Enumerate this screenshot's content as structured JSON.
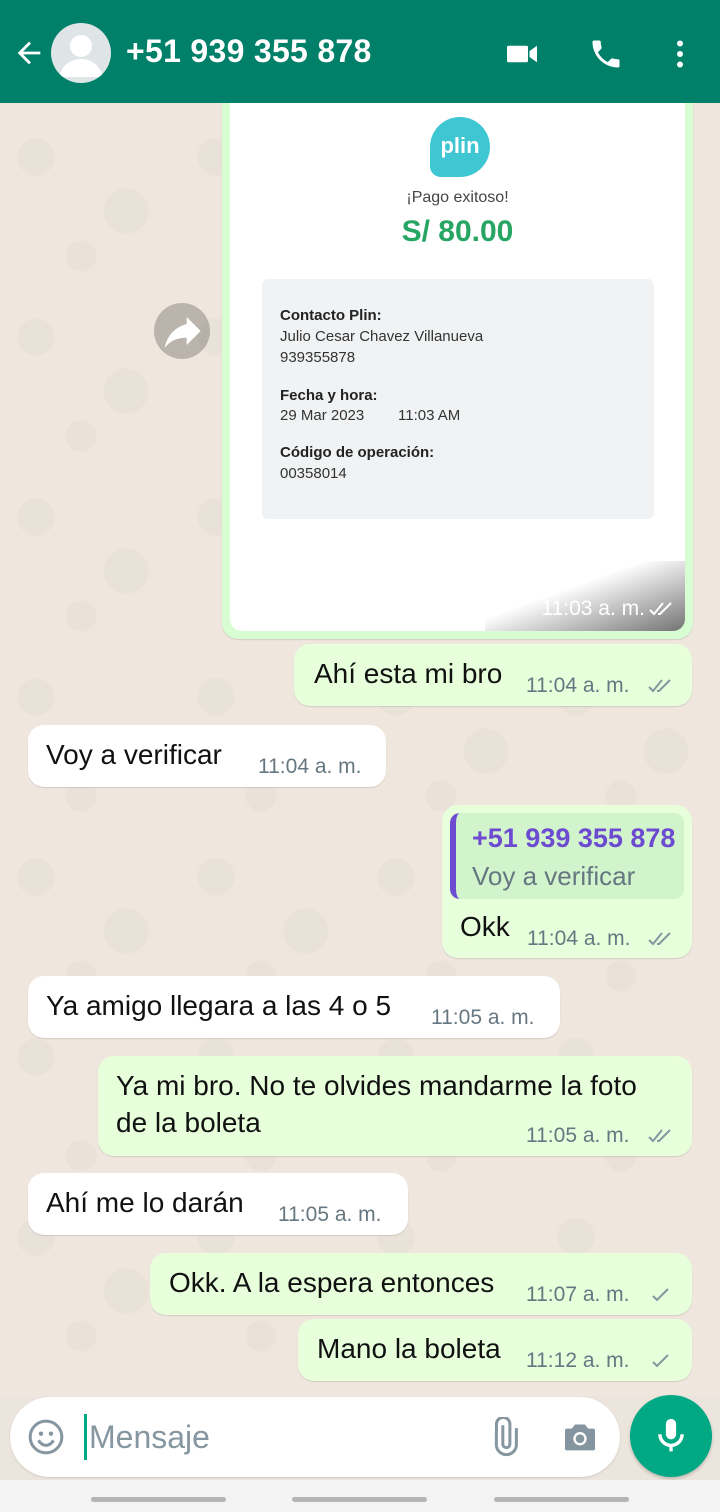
{
  "header": {
    "title": "+51 939 355 878",
    "icons": [
      "back-arrow-icon",
      "avatar",
      "video-call-icon",
      "phone-icon",
      "more-options-icon"
    ]
  },
  "image_message": {
    "logo_text": "plin",
    "status": "¡Pago exitoso!",
    "amount": "S/ 80.00",
    "contact_label": "Contacto Plin:",
    "contact_name": "Julio Cesar Chavez Villanueva",
    "contact_phone": "939355878",
    "datetime_label": "Fecha y hora:",
    "date": "29 Mar 2023",
    "time_value": "11:03 AM",
    "op_label": "Código de operación:",
    "op_code": "00358014",
    "time": "11:03 a. m."
  },
  "messages": [
    {
      "direction": "out",
      "text": "Ahí esta mi bro",
      "time": "11:04 a. m.",
      "status": "read"
    },
    {
      "direction": "in",
      "text": "Voy a verificar",
      "time": "11:04 a. m."
    },
    {
      "direction": "out",
      "quote_name": "+51 939 355 878",
      "quote_text": "Voy a verificar",
      "text": "Okk",
      "time": "11:04 a. m.",
      "status": "read"
    },
    {
      "direction": "in",
      "text": "Ya amigo llegara a las 4 o 5",
      "time": "11:05 a. m."
    },
    {
      "direction": "out",
      "text_line1": "Ya mi bro. No te olvides mandarme la foto",
      "text_line2": "de la boleta",
      "time": "11:05 a. m.",
      "status": "read"
    },
    {
      "direction": "in",
      "text": "Ahí me lo darán",
      "time": "11:05 a. m."
    },
    {
      "direction": "out",
      "text": "Okk. A la espera entonces",
      "time": "11:07 a. m.",
      "status": "sent"
    },
    {
      "direction": "out",
      "text": "Mano la boleta",
      "time": "11:12 a. m.",
      "status": "sent"
    }
  ],
  "composer": {
    "placeholder": "Mensaje",
    "icons": [
      "emoji-icon",
      "attach-icon",
      "camera-icon",
      "mic-icon"
    ]
  },
  "colors": {
    "header": "#008069",
    "outgoing_bubble": "#e7ffdb",
    "incoming_bubble": "#ffffff",
    "read_ticks": "#8696a0",
    "accent": "#00a884",
    "amount": "#27a562",
    "quote_accent": "#6d4bd1"
  }
}
